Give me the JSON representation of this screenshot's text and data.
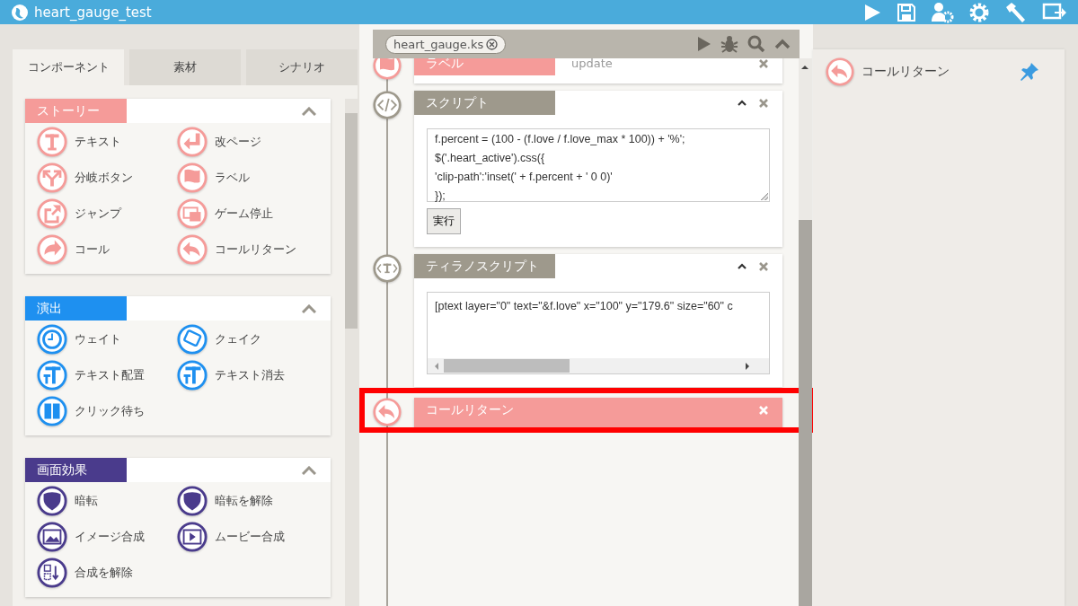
{
  "app": {
    "title": "heart_gauge_test"
  },
  "tabs": [
    {
      "label": "コンポーネント",
      "selected": true
    },
    {
      "label": "素材",
      "selected": false
    },
    {
      "label": "シナリオ",
      "selected": false
    }
  ],
  "sections": [
    {
      "title": "ストーリー",
      "color": "#f59b99",
      "expanded": true,
      "items": [
        {
          "label": "テキスト",
          "kind": "text"
        },
        {
          "label": "改ページ",
          "kind": "enter"
        },
        {
          "label": "分岐ボタン",
          "kind": "branch"
        },
        {
          "label": "ラベル",
          "kind": "flag"
        },
        {
          "label": "ジャンプ",
          "kind": "jump"
        },
        {
          "label": "ゲーム停止",
          "kind": "stop"
        },
        {
          "label": "コール",
          "kind": "call"
        },
        {
          "label": "コールリターン",
          "kind": "return"
        }
      ]
    },
    {
      "title": "演出",
      "color": "#1e90f0",
      "expanded": true,
      "items": [
        {
          "label": "ウェイト",
          "kind": "clock"
        },
        {
          "label": "クェイク",
          "kind": "quake"
        },
        {
          "label": "テキスト配置",
          "kind": "textpos"
        },
        {
          "label": "テキスト消去",
          "kind": "textpos"
        },
        {
          "label": "クリック待ち",
          "kind": "pause"
        }
      ]
    },
    {
      "title": "画面効果",
      "color": "#4a3b8c",
      "expanded": true,
      "items": [
        {
          "label": "暗転",
          "kind": "shield"
        },
        {
          "label": "暗転を解除",
          "kind": "shield"
        },
        {
          "label": "イメージ合成",
          "kind": "image"
        },
        {
          "label": "ムービー合成",
          "kind": "movie"
        },
        {
          "label": "合成を解除",
          "kind": "unmerge"
        }
      ]
    }
  ],
  "editor": {
    "file_tab": "heart_gauge.ks"
  },
  "blocks": [
    {
      "kind": "label",
      "title": "ラベル",
      "value": "update",
      "highlighted": false
    },
    {
      "kind": "script",
      "title": "スクリプト",
      "code": "f.percent = (100 - (f.love / f.love_max * 100)) + '%';\n$('.heart_active').css({\n'clip-path':'inset(' + f.percent + ' 0 0)'\n});",
      "button": "実行",
      "highlighted": false
    },
    {
      "kind": "tyrano",
      "title": "ティラノスクリプト",
      "code": "[ptext layer=\"0\" text=\"&f.love\" x=\"100\" y=\"179.6\" size=\"60\" c",
      "highlighted": false
    },
    {
      "kind": "return",
      "title": "コールリターン",
      "highlighted": true
    }
  ],
  "inspector": {
    "title": "コールリターン"
  }
}
